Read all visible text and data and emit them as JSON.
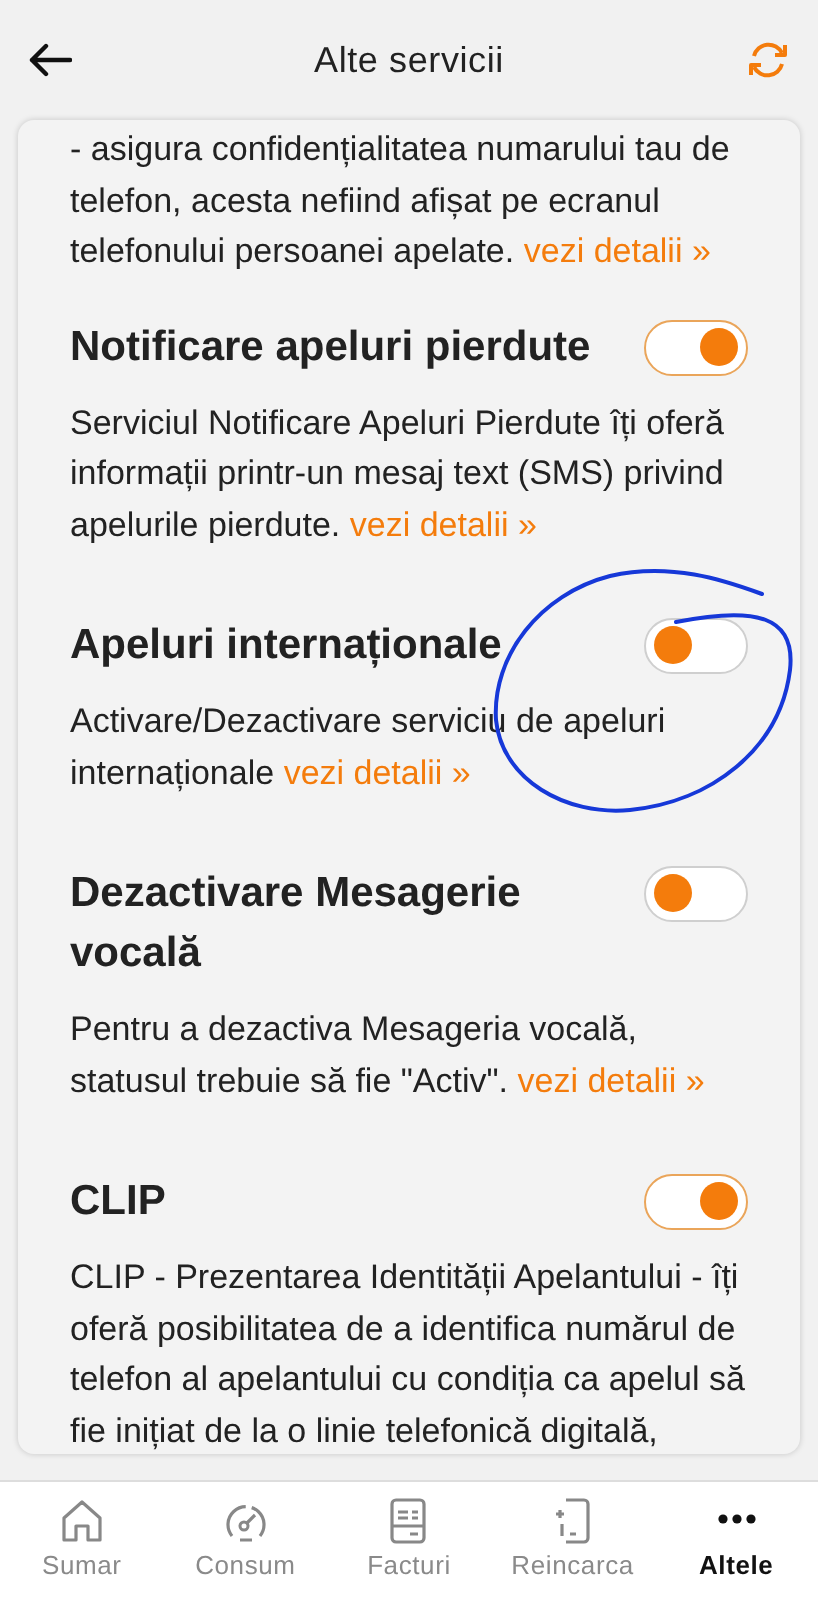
{
  "header": {
    "title": "Alte servicii"
  },
  "intro": {
    "text": "- asigura confidențialitatea numarului tau de telefon, acesta nefiind afișat pe ecranul telefonului persoanei apelate.",
    "link": "vezi detalii »"
  },
  "services": [
    {
      "title": "Notificare apeluri pierdute",
      "on": true,
      "description": "Serviciul Notificare Apeluri Pierdute îți oferă informații printr-un mesaj text (SMS) privind apelurile pierdute.",
      "link": "vezi detalii »"
    },
    {
      "title": "Apeluri internaționale",
      "on": false,
      "description": "Activare/Dezactivare serviciu de apeluri internaționale",
      "link": "vezi detalii »"
    },
    {
      "title": "Dezactivare Mesagerie vocală",
      "on": false,
      "description": "Pentru a dezactiva Mesageria vocală, statusul trebuie să fie \"Activ\".",
      "link": "vezi detalii »"
    },
    {
      "title": "CLIP",
      "on": true,
      "description": "CLIP - Prezentarea Identității Apelantului - îți oferă posibilitatea de a identifica numărul de telefon al apelantului cu condiția ca apelul să fie inițiat de la o linie telefonică digitală,"
    }
  ],
  "tabs": [
    {
      "label": "Sumar",
      "kind": "home",
      "selected": false
    },
    {
      "label": "Consum",
      "kind": "gauge",
      "selected": false
    },
    {
      "label": "Facturi",
      "kind": "invoice",
      "selected": false
    },
    {
      "label": "Reincarca",
      "kind": "phone",
      "selected": false
    },
    {
      "label": "Altele",
      "kind": "more",
      "selected": true
    }
  ]
}
